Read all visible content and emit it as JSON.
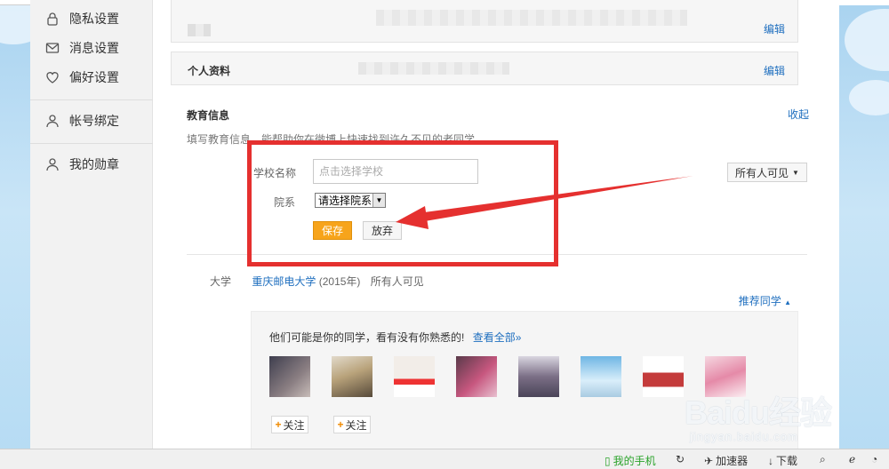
{
  "sidebar": {
    "items": [
      {
        "label": "隐私设置",
        "icon": "lock-icon"
      },
      {
        "label": "消息设置",
        "icon": "message-icon"
      },
      {
        "label": "偏好设置",
        "icon": "heart-icon"
      },
      {
        "label": "帐号绑定",
        "icon": "user-icon"
      },
      {
        "label": "我的勋章",
        "icon": "medal-icon"
      }
    ]
  },
  "sections": {
    "privacy_edit": "编辑",
    "profile": {
      "title": "个人资料",
      "edit": "编辑"
    },
    "education": {
      "title": "教育信息",
      "collapse": "收起",
      "description": "填写教育信息，能帮助你在微博上快速找到许久不见的老同学",
      "form": {
        "school_label": "学校名称",
        "school_placeholder": "点击选择学校",
        "dept_label": "院系",
        "dept_value": "请选择院系",
        "save": "保存",
        "cancel": "放弃",
        "visibility": "所有人可见"
      },
      "entry": {
        "type": "大学",
        "school": "重庆邮电大学",
        "year": "(2015年)",
        "visibility": "所有人可见"
      },
      "recommend_link": "推荐同学",
      "recommend": {
        "title": "他们可能是你的同学，看有没有你熟悉的!",
        "view_all": "查看全部»",
        "follow_label": "关注"
      }
    }
  },
  "status_bar": {
    "phone": "我的手机",
    "accelerator": "加速器",
    "download": "下载"
  },
  "watermark": {
    "logo": "Baidu经验",
    "url": "jingyan.baidu.com"
  },
  "colors": {
    "accent_orange": "#f7a41b",
    "link_blue": "#1f6fbf",
    "annotation_red": "#e5302f"
  }
}
